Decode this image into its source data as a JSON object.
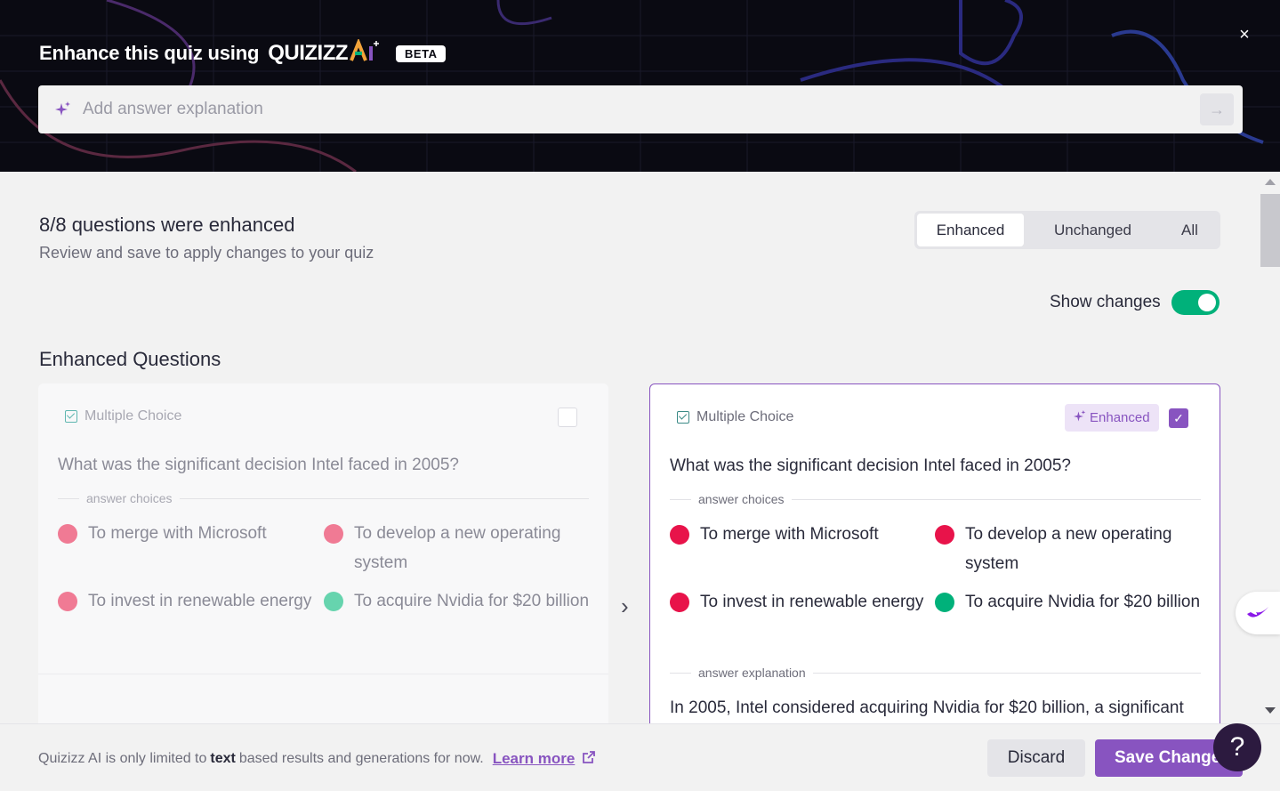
{
  "header": {
    "title": "Enhance this quiz using",
    "brand": "QUIZIZZ",
    "brand_ai": "AI",
    "beta": "BETA",
    "close_label": "×",
    "prompt_placeholder": "Add answer explanation"
  },
  "summary": {
    "title": "8/8 questions were enhanced",
    "subtitle": "Review and save to apply changes to your quiz"
  },
  "filters": {
    "tabs": [
      {
        "label": "Enhanced",
        "active": true
      },
      {
        "label": "Unchanged",
        "active": false
      },
      {
        "label": "All",
        "active": false
      }
    ]
  },
  "show_changes": {
    "label": "Show changes",
    "on": true
  },
  "section_title": "Enhanced Questions",
  "original": {
    "type": "Multiple Choice",
    "question": "What was the significant decision Intel faced in 2005?",
    "choices_label": "answer choices",
    "choices": [
      {
        "text": "To merge with Microsoft",
        "correct": false
      },
      {
        "text": "To develop a new operating system",
        "correct": false
      },
      {
        "text": "To invest in renewable energy",
        "correct": false
      },
      {
        "text": "To acquire Nvidia for $20 billion",
        "correct": true
      }
    ]
  },
  "enhanced": {
    "type": "Multiple Choice",
    "badge": "Enhanced",
    "question": "What was the significant decision Intel faced in 2005?",
    "choices_label": "answer choices",
    "choices": [
      {
        "text": "To merge with Microsoft",
        "correct": false
      },
      {
        "text": "To develop a new operating system",
        "correct": false
      },
      {
        "text": "To invest in renewable energy",
        "correct": false
      },
      {
        "text": "To acquire Nvidia for $20 billion",
        "correct": true
      }
    ],
    "explanation_label": "answer explanation",
    "explanation": "In 2005, Intel considered acquiring Nvidia for $20 billion, a significant"
  },
  "footer": {
    "note_prefix": "Quizizz AI is only limited to",
    "note_bold": "text",
    "note_suffix": "based results and generations for now.",
    "learn_more": "Learn more",
    "discard": "Discard",
    "save": "Save Changes",
    "help": "?"
  },
  "colors": {
    "accent": "#8854c0",
    "correct": "#00b17a",
    "incorrect": "#e8134a",
    "toggle_on": "#00b17a"
  }
}
